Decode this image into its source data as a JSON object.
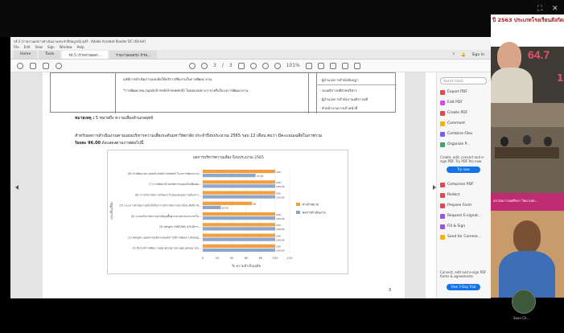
{
  "screen": {
    "close_glyph": "✕",
    "fullscreen_glyph": "⛶"
  },
  "app": {
    "title_bar": "ร4.5 (รายงานผลการดำเนินงานประจำปีสมบูรณ์).pdf - Adobe Acrobat Reader DC (64-bit)",
    "menu": [
      "File",
      "Edit",
      "View",
      "Sign",
      "Window",
      "Help"
    ],
    "tabs": [
      {
        "label": "Home"
      },
      {
        "label": "Tools"
      },
      {
        "label": "ร4.5 (รายงานผลก..."
      },
      {
        "label": "รายงานผลสรุป #รอ..."
      }
    ],
    "right_controls": [
      "?",
      "🔔",
      "Sign In"
    ],
    "page_current": "3",
    "page_total": "3",
    "zoom": "101%"
  },
  "document": {
    "table_cells": {
      "row1_col2": "แต่มีการดำเนินการแบบจัดให้บริการ/ทีมงานในการพัฒนางาน",
      "row2_col2": "*การพัฒนาคน (upskill-reskill-newskill) โดยอบรมทางวาจาหรือในวงการพัฒนางาน",
      "col3_a": "- ผู้อำนวยการสำนักคิดปฏา",
      "col3_b": "- รองอธิการบดีฝ่ายบริหาร",
      "col3_c": "- ผู้อำนวยการสำนักงานอธิการบดี",
      "col3_d": "- หัวหน้างานการเจ้าหน้าที่"
    },
    "remark_label": "หมายเหตุ :",
    "remark_text": "5 หมายถึง ความเสี่ยงด้านกลยุทธ์",
    "paragraph_1": "สำหรับผลการดำเนินงานตามแผนบริหารความเสี่ยงระดับมหาวิทยาลัย ประจำปีงบประมาณ 2565 รอบ 12 เดือน พบว่า มีคะแนนเฉลี่ยในภาพรวม",
    "paragraph_2_bold": "ร้อยละ 96.00",
    "paragraph_2_rest": "ดังแสดงตามภาพต่อไปนี้",
    "page_number": "3"
  },
  "chart_data": {
    "type": "bar",
    "orientation": "horizontal",
    "title": "ผลการบริหารความเสี่ยง ปีงบประมาณ 2565",
    "xlabel": "% ความสำเร็จเฉลี่ย",
    "ylabel": "ประเด็นเสี่ยง",
    "xlim": [
      0,
      120
    ],
    "xticks": [
      0,
      20,
      40,
      60,
      80,
      100,
      120
    ],
    "categories": [
      "(1) มีเกณฑ์การพัฒนา (age group/ non-age group) ของ...",
      "(2) หลักสูตร upskill-reskill-newskill ไม่มีการพัฒนา Lifelong...",
      "(3) หลักสูตร CWIE/WIL ยังไม่มีการ...",
      "(4) ระบบบริหารจัดการฐานข้อมูลพื้นฐานจากหน่วยงานภายใน...",
      "(5) ระบบการดำเนินงานยังไม่ได้รับการบริหารจัดการอย่างมีประสิทธิภาพ...",
      "(6) การบริหารจัดการทรัพยากรไม่ตอบสนองความต้องการ...",
      "(7) การพัฒนาด้านทรัพยากรบุคคลไม่เพียงพอ...",
      "(8) การพัฒนาคน upskill-reskill-newskill ในวงการพัฒนางาน..."
    ],
    "series": [
      {
        "name": "ค่าเป้าหมาย",
        "color": "#f0a040",
        "values": [
          100,
          100,
          100,
          100,
          68,
          100,
          100,
          100
        ]
      },
      {
        "name": "ผลการดำเนินงาน",
        "color": "#8da6c9",
        "values": [
          100,
          100,
          100,
          100,
          25,
          100,
          100,
          73
        ]
      }
    ],
    "data_labels": [
      [
        "100",
        "100",
        "100",
        "100",
        "68",
        "100",
        "100",
        "100"
      ],
      [
        "100.00",
        "100.00",
        "100.00",
        "100.00",
        "25.00",
        "100.00",
        "100.00",
        "73.33"
      ]
    ],
    "legend_position": "right",
    "grid": true
  },
  "sidebar": {
    "search_placeholder": "Search tools",
    "items": [
      {
        "label": "Export PDF",
        "color": "#e34850"
      },
      {
        "label": "Edit PDF",
        "color": "#d14df1"
      },
      {
        "label": "Create PDF",
        "color": "#e34850"
      },
      {
        "label": "Comment",
        "color": "#f5b400"
      },
      {
        "label": "Combine Files",
        "color": "#7b5cf0"
      },
      {
        "label": "Organize P...",
        "color": "#3fa66b"
      }
    ],
    "note": "Create, edit, convert and e-sign PDF. Try PDF Pro now",
    "try_now": "Try now",
    "items2": [
      {
        "label": "Compress PDF",
        "color": "#e34850"
      },
      {
        "label": "Redact",
        "color": "#e34850"
      },
      {
        "label": "Prepare Form",
        "color": "#e34850"
      },
      {
        "label": "Request E-signat...",
        "color": "#9a55e0"
      },
      {
        "label": "Fill & Sign",
        "color": "#9a55e0"
      },
      {
        "label": "Send for Comme...",
        "color": "#f5b400"
      }
    ],
    "footer": "Convert, edit and e-sign PDF forms & agreements",
    "free_trial": "Free 7-Day Trial"
  },
  "video": {
    "top_slide_title": "ปี 2563 ประเภทโรงเรียนสังกัดสถาบันฯ",
    "big_number": "64.7",
    "big_number_2": "1",
    "banner_text": "สถาบันการพลศึกษา วิทยาเขต…",
    "participant_name": "Sean Ch..."
  }
}
